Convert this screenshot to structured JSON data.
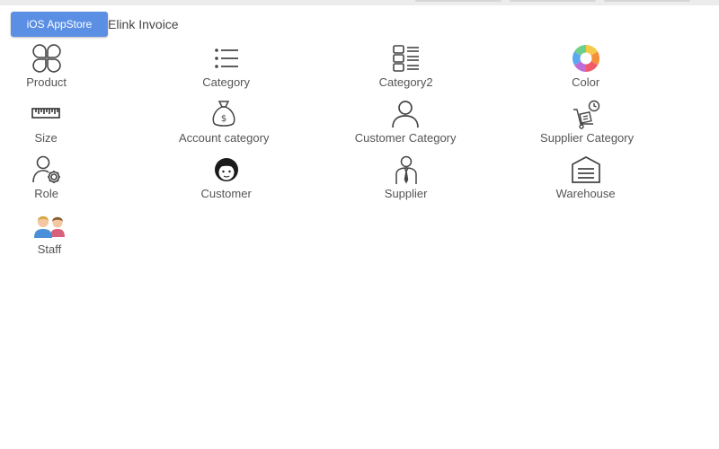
{
  "header": {
    "appstore_button": "iOS AppStore",
    "app_title": "Elink Invoice"
  },
  "menu": [
    [
      "Product",
      "Category",
      "Category2",
      "Color"
    ],
    [
      "Size",
      "Account category",
      "Customer Category",
      "Supplier Category"
    ],
    [
      "Role",
      "Customer",
      "Supplier",
      "Warehouse"
    ],
    [
      "Staff"
    ]
  ],
  "icons": {
    "product": "clover-icon",
    "category": "list-icon",
    "category2": "grid-list-icon",
    "color": "color-wheel-icon",
    "size": "ruler-icon",
    "account_category": "money-bag-icon",
    "customer_category": "person-outline-icon",
    "supplier_category": "hand-truck-icon",
    "role": "user-gear-icon",
    "customer": "customer-face-icon",
    "supplier": "businessman-icon",
    "warehouse": "warehouse-icon",
    "staff": "staff-people-icon"
  },
  "colors": {
    "accent": "#5b8fe4",
    "icon_stroke": "#444444"
  }
}
